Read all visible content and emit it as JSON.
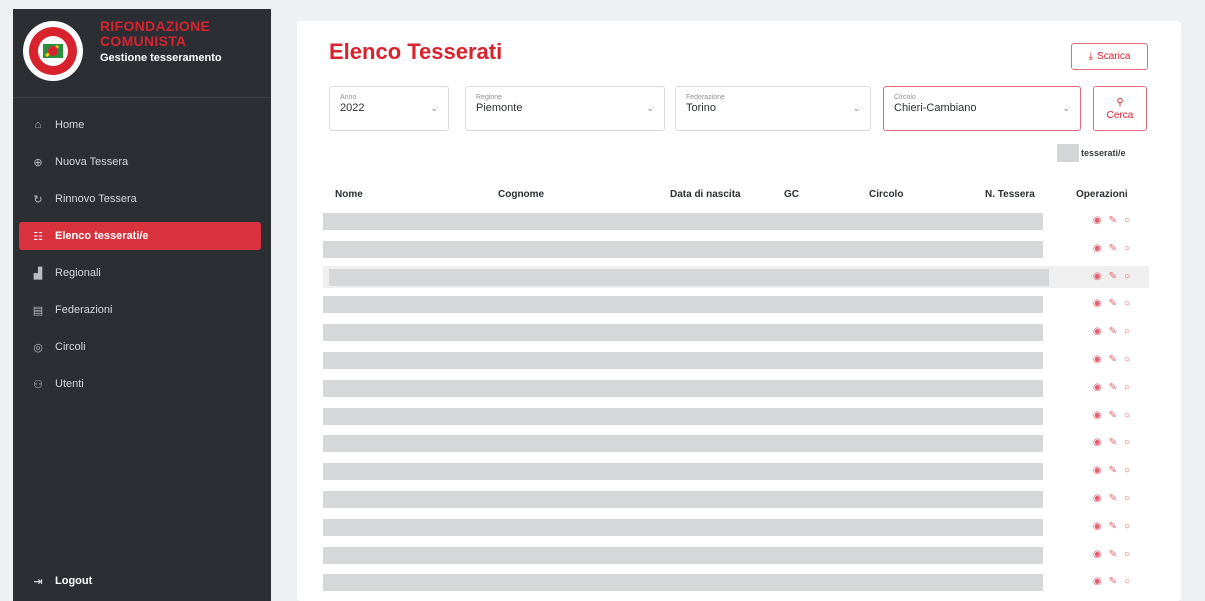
{
  "brand": {
    "title_line1": "RIFONDAZIONE",
    "title_line2": "COMUNISTA",
    "subtitle": "Gestione tesseramento"
  },
  "sidebar": {
    "items": [
      {
        "label": "Home",
        "icon": "home-icon"
      },
      {
        "label": "Nuova Tessera",
        "icon": "plus-circle-icon"
      },
      {
        "label": "Rinnovo Tessera",
        "icon": "refresh-icon"
      },
      {
        "label": "Elenco tesserati/e",
        "icon": "list-icon",
        "active": true
      },
      {
        "label": "Regionali",
        "icon": "chart-icon"
      },
      {
        "label": "Federazioni",
        "icon": "building-icon"
      },
      {
        "label": "Circoli",
        "icon": "circle-group-icon"
      },
      {
        "label": "Utenti",
        "icon": "users-icon"
      }
    ],
    "logout": "Logout"
  },
  "main": {
    "title": "Elenco Tesserati",
    "download_label": "Scarica",
    "filters": {
      "anno": {
        "label": "Anno",
        "value": "2022"
      },
      "regione": {
        "label": "Regione",
        "value": "Piemonte"
      },
      "federazione": {
        "label": "Federazione",
        "value": "Torino"
      },
      "circolo": {
        "label": "Circolo",
        "value": "Chieri-Cambiano"
      }
    },
    "search_label": "Cerca",
    "count_label": "tesserati/e",
    "table": {
      "headers": [
        "Nome",
        "Cognome",
        "Data di nascita",
        "GC",
        "Circolo",
        "N. Tessera",
        "Operazioni"
      ],
      "row_count_visible": 15
    }
  },
  "colors": {
    "accent": "#d8232e",
    "sidebar_bg": "#2b2e33",
    "active_item": "#d8323f",
    "page_bg": "#eef0f3"
  }
}
